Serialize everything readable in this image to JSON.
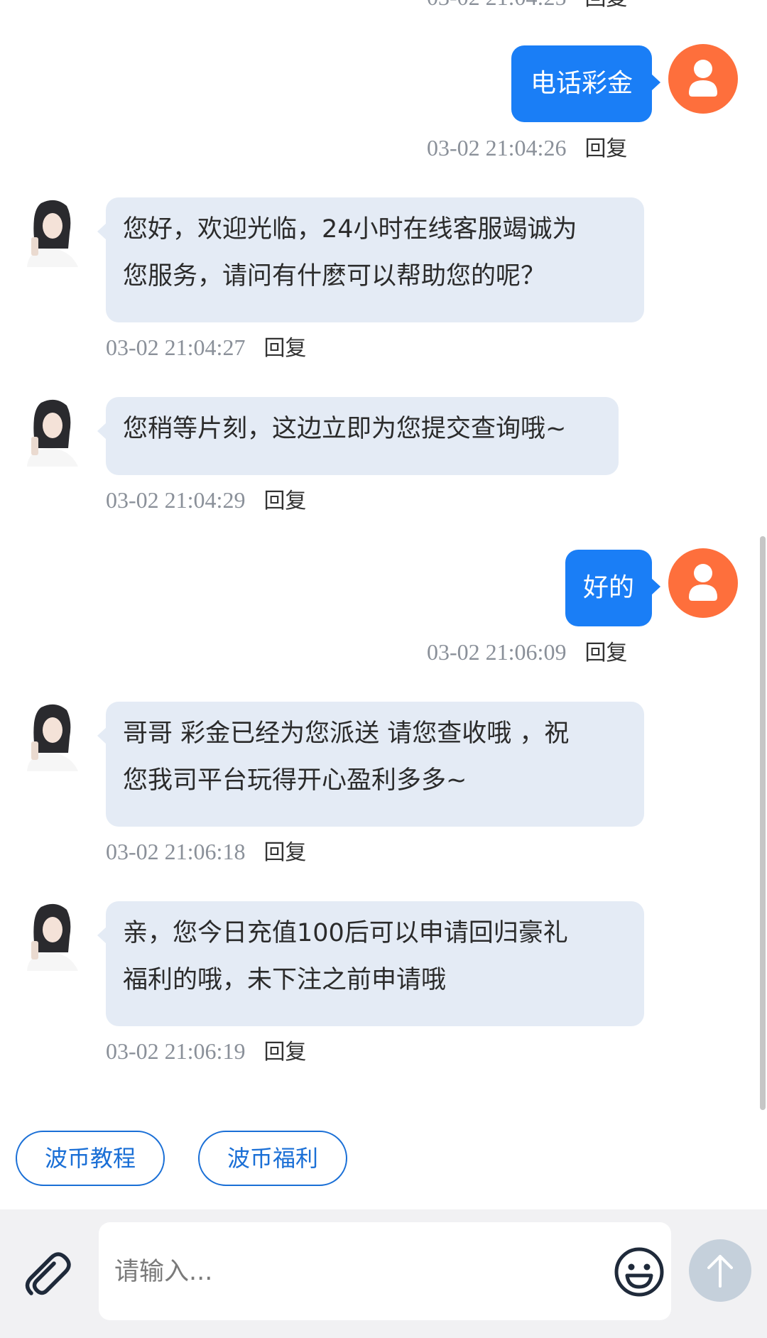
{
  "chat": {
    "messages": [
      {
        "from": "user",
        "text": "电话彩金",
        "time": "03-02 21:04:26",
        "reply": "回复"
      },
      {
        "from": "agent",
        "line1": "您好，欢迎光临，24小时在线客服竭诚为",
        "line2": "您服务，请问有什麽可以帮助您的呢？",
        "time": "03-02 21:04:27",
        "reply": "回复"
      },
      {
        "from": "agent",
        "line1": "您稍等片刻，这边立即为您提交查询哦~",
        "time": "03-02 21:04:29",
        "reply": "回复"
      },
      {
        "from": "user",
        "text": "好的",
        "time": "03-02 21:06:09",
        "reply": "回复"
      },
      {
        "from": "agent",
        "line1": "哥哥 彩金已经为您派送 请您查收哦 ，祝",
        "line2": "您我司平台玩得开心盈利多多~",
        "time": "03-02 21:06:18",
        "reply": "回复"
      },
      {
        "from": "agent",
        "line1": "亲，您今日充值100后可以申请回归豪礼",
        "line2": "福利的哦，未下注之前申请哦",
        "time": "03-02 21:06:19",
        "reply": "回复"
      }
    ]
  },
  "quick_replies": [
    "波币教程",
    "波币福利"
  ],
  "input": {
    "placeholder": "请输入...",
    "value": ""
  },
  "icons": {
    "attach": "paperclip-icon",
    "emoji": "smile-icon",
    "send": "arrow-up-icon",
    "user_avatar": "user-icon"
  },
  "colors": {
    "user_bubble": "#1a7ef6",
    "agent_bubble": "#e4ebf5",
    "user_avatar": "#fe6f3c",
    "chip_border": "#1a6fd6",
    "send_button": "#c5d0db"
  }
}
